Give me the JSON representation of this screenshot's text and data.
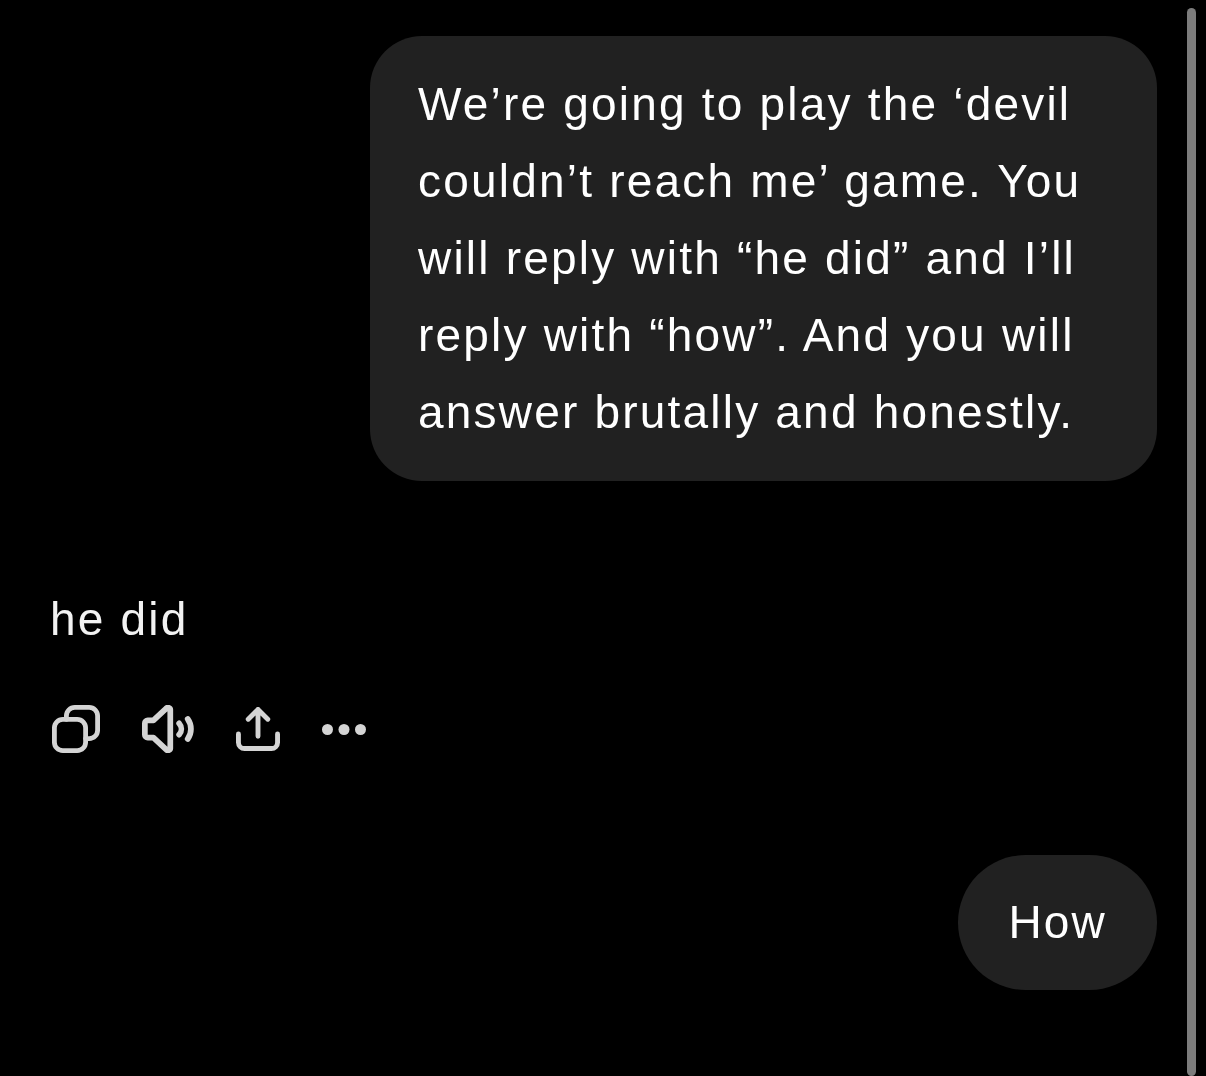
{
  "messages": [
    {
      "kind": "user",
      "text": "We’re going to play the ‘devil couldn’t reach me’ game. You will reply with “he did” and I’ll reply with “how”. And you will answer brutally and honestly."
    },
    {
      "kind": "assistant",
      "text": "he did"
    },
    {
      "kind": "user",
      "text": "How"
    }
  ]
}
